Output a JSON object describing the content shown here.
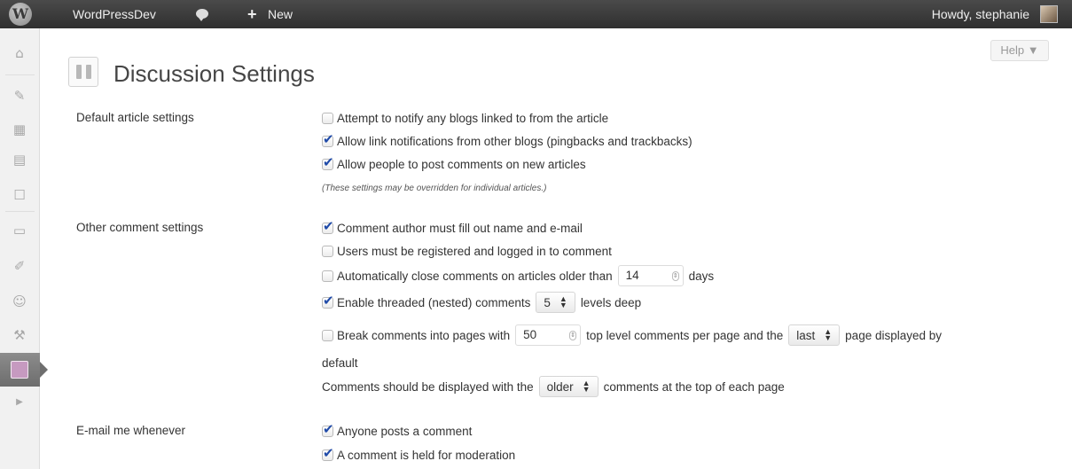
{
  "admin_bar": {
    "wp_logo_char": "W",
    "site_name": "WordPressDev",
    "new_plus": "+",
    "new_label": "New",
    "howdy": "Howdy, stephanie"
  },
  "help": {
    "label": "Help ▼"
  },
  "page": {
    "title": "Discussion Settings"
  },
  "sidebar": {
    "icons": [
      "dashboard-icon",
      "posts-icon",
      "media-icon",
      "pages-icon",
      "comments-icon",
      "appearance-icon",
      "plugins-icon",
      "users-icon",
      "tools-icon",
      "settings-icon",
      "collapse-icon"
    ],
    "glyphs": [
      "⌂",
      "✎",
      "▦",
      "▤",
      "☐",
      "▭",
      "✐",
      "☺",
      "⚒",
      "",
      "▶"
    ]
  },
  "sections": {
    "default_article": {
      "label": "Default article settings",
      "options": [
        {
          "text": "Attempt to notify any blogs linked to from the article",
          "checked": false
        },
        {
          "text": "Allow link notifications from other blogs (pingbacks and trackbacks)",
          "checked": true
        },
        {
          "text": "Allow people to post comments on new articles",
          "checked": true
        }
      ],
      "note": "(These settings may be overridden for individual articles.)"
    },
    "other_comment": {
      "label": "Other comment settings",
      "author_fill": {
        "text": "Comment author must fill out name and e-mail",
        "checked": true
      },
      "registered": {
        "text": "Users must be registered and logged in to comment",
        "checked": false
      },
      "auto_close": {
        "text_before": "Automatically close comments on articles older than",
        "days_value": "14",
        "text_after": "days",
        "checked": false
      },
      "threaded": {
        "text_before": "Enable threaded (nested) comments",
        "levels_value": "5",
        "text_after": "levels deep",
        "checked": true
      },
      "paging": {
        "text_before": "Break comments into pages with",
        "per_page_value": "50",
        "text_middle": "top level comments per page and the",
        "page_select": "last",
        "text_after": "page displayed by",
        "text_wrap": "default",
        "checked": false
      },
      "order": {
        "text_before": "Comments should be displayed with the",
        "order_select": "older",
        "text_after": "comments at the top of each page"
      }
    },
    "email_me": {
      "label": "E-mail me whenever",
      "options": [
        {
          "text": "Anyone posts a comment",
          "checked": true
        },
        {
          "text": "A comment is held for moderation",
          "checked": true
        }
      ]
    }
  },
  "colors": {
    "admin_bar": "#3a3a3a",
    "check": "#1f4aa8",
    "active_menu": "#7a7a7a"
  }
}
